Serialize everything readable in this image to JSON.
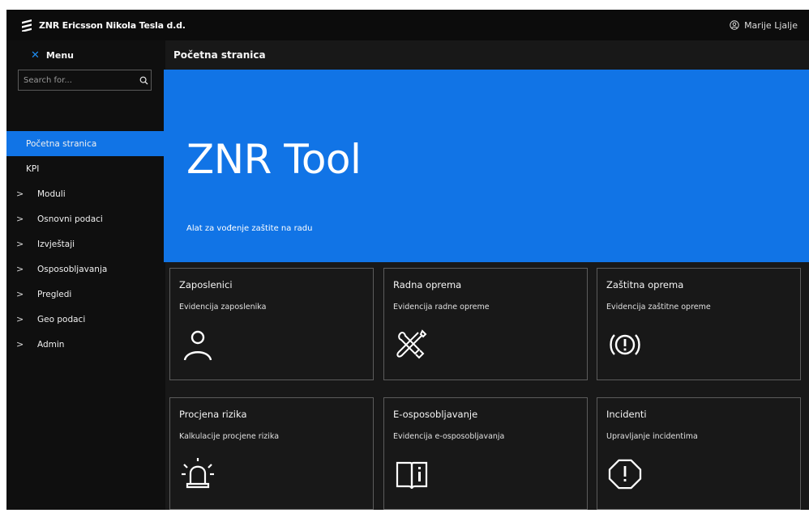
{
  "header": {
    "app_title": "ZNR Ericsson Nikola Tesla d.d.",
    "user_name": "Marije Ljalje",
    "logo_icon": "ericsson-logo",
    "user_icon": "user-circle-icon"
  },
  "sidebar": {
    "menu_label": "Menu",
    "close_icon": "close-icon",
    "search": {
      "placeholder": "Search for...",
      "value": ""
    },
    "items": [
      {
        "label": "Početna stranica",
        "active": true,
        "expandable": false
      },
      {
        "label": "KPI",
        "active": false,
        "expandable": false
      },
      {
        "label": "Moduli",
        "active": false,
        "expandable": true
      },
      {
        "label": "Osnovni podaci",
        "active": false,
        "expandable": true
      },
      {
        "label": "Izvještaji",
        "active": false,
        "expandable": true
      },
      {
        "label": "Osposobljavanja",
        "active": false,
        "expandable": true
      },
      {
        "label": "Pregledi",
        "active": false,
        "expandable": true
      },
      {
        "label": "Geo podaci",
        "active": false,
        "expandable": true
      },
      {
        "label": "Admin",
        "active": false,
        "expandable": true
      }
    ]
  },
  "main": {
    "breadcrumb": "Početna stranica",
    "hero": {
      "title": "ZNR Tool",
      "subtitle": "Alat za vođenje zaštite na radu"
    },
    "cards": [
      {
        "title": "Zaposlenici",
        "description": "Evidencija zaposlenika",
        "icon": "user-icon"
      },
      {
        "title": "Radna oprema",
        "description": "Evidencija radne opreme",
        "icon": "tools-icon"
      },
      {
        "title": "Zaštitna oprema",
        "description": "Evidencija zaštitne opreme",
        "icon": "warning-circle-icon"
      },
      {
        "title": "Procjena rizika",
        "description": "Kalkulacije procjene rizika",
        "icon": "alarm-icon"
      },
      {
        "title": "E-osposobljavanje",
        "description": "Evidencija e-osposobljavanja",
        "icon": "book-info-icon"
      },
      {
        "title": "Incidenti",
        "description": "Upravljanje incidentima",
        "icon": "warning-octagon-icon"
      }
    ]
  },
  "colors": {
    "accent": "#1174e6",
    "background": "#181818",
    "topbar": "#0c0c0c",
    "sidebar": "#0f0f0f",
    "card_border": "#5c5c5c"
  }
}
